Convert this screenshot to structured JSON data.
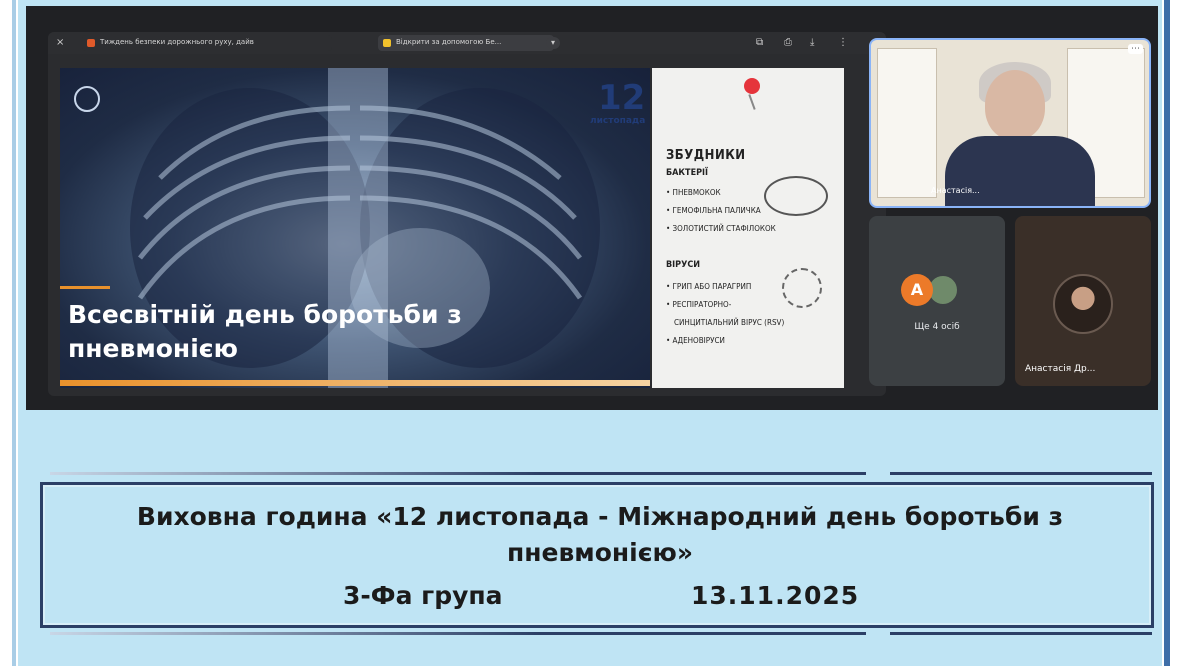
{
  "browser": {
    "tab1_title": "Тиждень безпеки дорожнього руху, дайв",
    "tab2_title": "Відкрити за допомогою Бе..."
  },
  "slide": {
    "date_number": "12",
    "date_month": "листопада",
    "logo_text": "",
    "title": "Всесвітній день боротьби з пневмонією",
    "pathogens_heading": "ЗБУДНИКИ",
    "bacteria_heading": "БАКТЕРІЇ",
    "bacteria": [
      "ПНЕВМОКОК",
      "ГЕМОФІЛЬНА ПАЛИЧКА",
      "ЗОЛОТИСТИЙ СТАФІЛОКОК"
    ],
    "viruses_heading": "ВІРУСИ",
    "viruses": [
      "ГРИП АБО ПАРАГРИП",
      "РЕСПІРАТОРНО-",
      "СИНЦИТІАЛЬНИЙ ВІРУС (RSV)",
      "АДЕНОВІРУСИ"
    ]
  },
  "participants": {
    "camera_name": "Анастасія...",
    "more_label": "Ще 4 осіб",
    "more_avatar_letter": "A",
    "anastasia_label": "Анастасія Др..."
  },
  "caption": {
    "title_line": "Виховна година «12 листопада - Міжнародний день боротьби з пневмонією»",
    "group": "3-Фа група",
    "date": "13.11.2025"
  },
  "colors": {
    "caption_bg": "#bfe4f4",
    "caption_border": "#2b3f66",
    "meet_bg": "#202124",
    "slide_accent": "#213c78",
    "avatar_orange": "#ec7a29"
  }
}
